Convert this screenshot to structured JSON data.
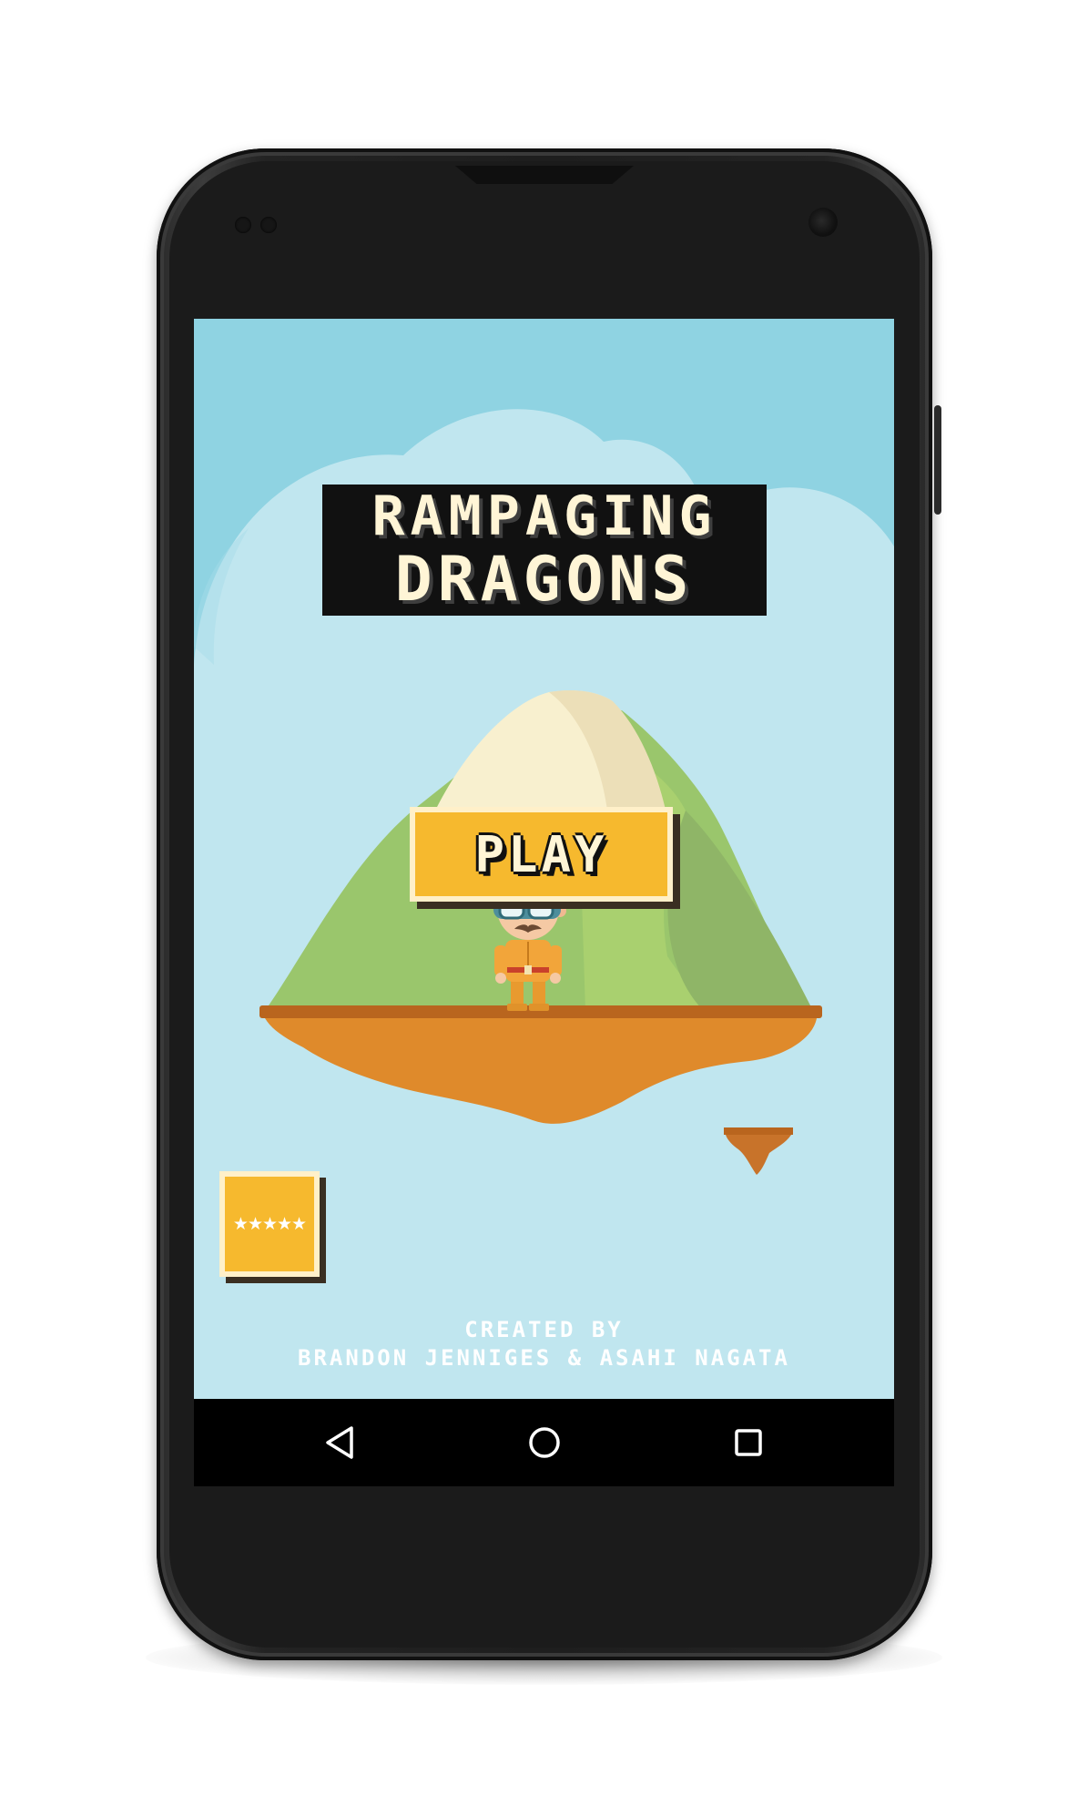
{
  "game": {
    "title_line1": "RAMPAGING",
    "title_line2": "DRAGONS",
    "play_label": "PLAY",
    "rate_label": "★★★★★",
    "credits_line1": "CREATED BY",
    "credits_line2": "BRANDON JENNIGES & ASAHI NAGATA"
  },
  "navbar": {
    "back_icon": "back-triangle-icon",
    "home_icon": "home-circle-icon",
    "recents_icon": "recents-square-icon"
  },
  "colors": {
    "sky": "#8fd3e2",
    "cloud": "#c0e6ef",
    "button": "#f6b92e",
    "button_border": "#fff0c9",
    "island_dirt": "#df8a2b",
    "grass": "#9ac66c",
    "snow": "#f8f0cf"
  }
}
